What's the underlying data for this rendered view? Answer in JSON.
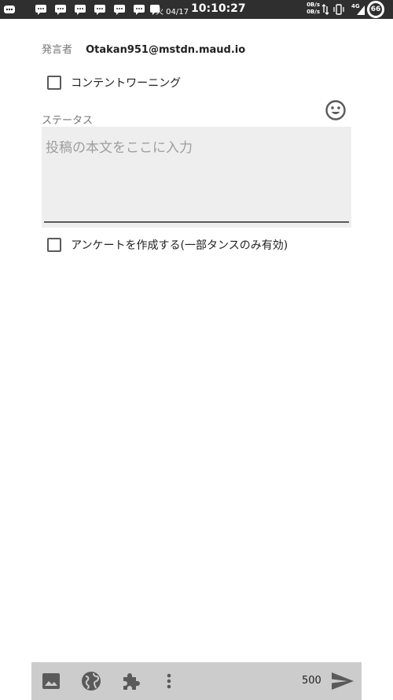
{
  "status_bar": {
    "date": "火 04/17",
    "time": "10:10:27",
    "net_up": "0B/s",
    "net_down": "0B/s",
    "network_type": "4G",
    "battery": "66",
    "notification_icons": [
      "more-icon",
      "chat-icon",
      "chat-icon",
      "chat-icon",
      "chat-icon",
      "chat-icon",
      "chat-icon",
      "chat-icon"
    ]
  },
  "compose": {
    "account_label": "発言者",
    "account_value": "Otakan951@mstdn.maud.io",
    "content_warning_label": "コンテントワーニング",
    "content_warning_checked": false,
    "status_label": "ステータス",
    "status_placeholder": "投稿の本文をここに入力",
    "poll_label": "アンケートを作成する(一部タンスのみ有効)",
    "poll_checked": false,
    "emoji_icon": "emoji-icon"
  },
  "toolbar": {
    "icons": [
      "image-icon",
      "globe-icon",
      "puzzle-icon",
      "more-vert-icon",
      "send-icon"
    ],
    "char_count": "500"
  },
  "colors": {
    "status_bar_bg": "#2f2f2f",
    "textarea_bg": "#eeeeee",
    "toolbar_bg": "#cccccc",
    "icon_gray": "#5a5a5a"
  }
}
